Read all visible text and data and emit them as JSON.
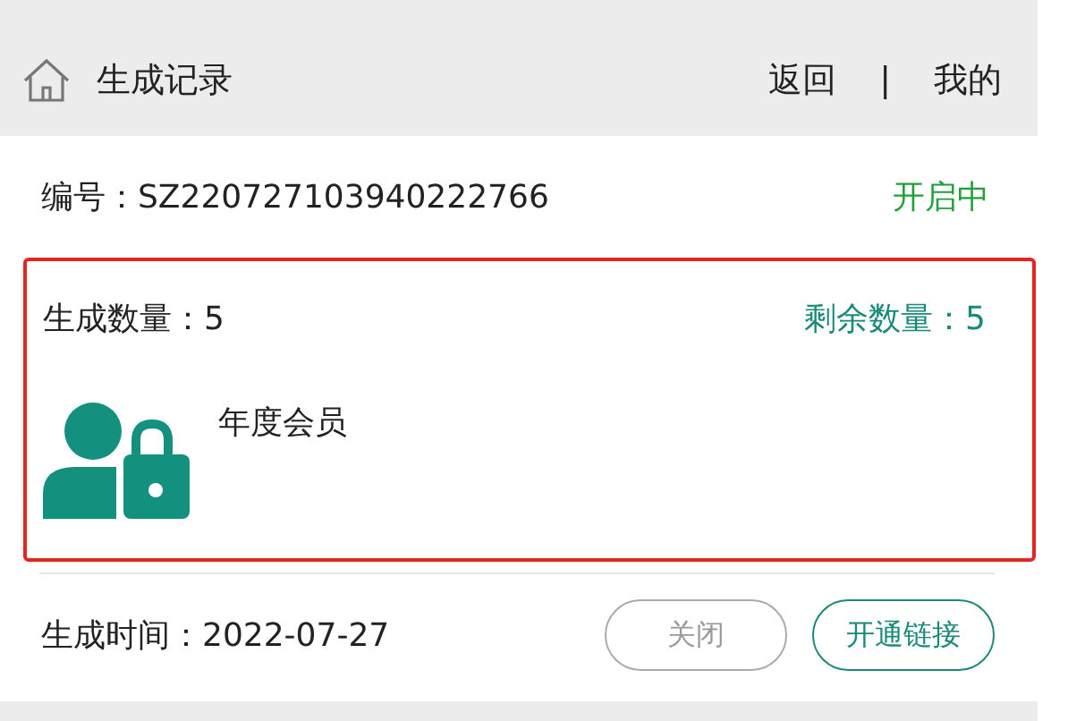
{
  "header": {
    "title": "生成记录",
    "links": [
      "返回",
      "我的"
    ],
    "separator": "|"
  },
  "record": {
    "number_label": "编号：",
    "number": "SZ220727103940222766",
    "status": "开启中",
    "active": true,
    "generated_label": "生成数量：",
    "generated": "5",
    "remaining_label": "剩余数量：",
    "remaining": "5",
    "product": "年度会员",
    "time_label": "生成时间：",
    "time": "2022-07-27",
    "buttons": [
      {
        "label": "关闭",
        "disabled": true
      },
      {
        "label": "开通链接",
        "disabled": false
      }
    ]
  }
}
